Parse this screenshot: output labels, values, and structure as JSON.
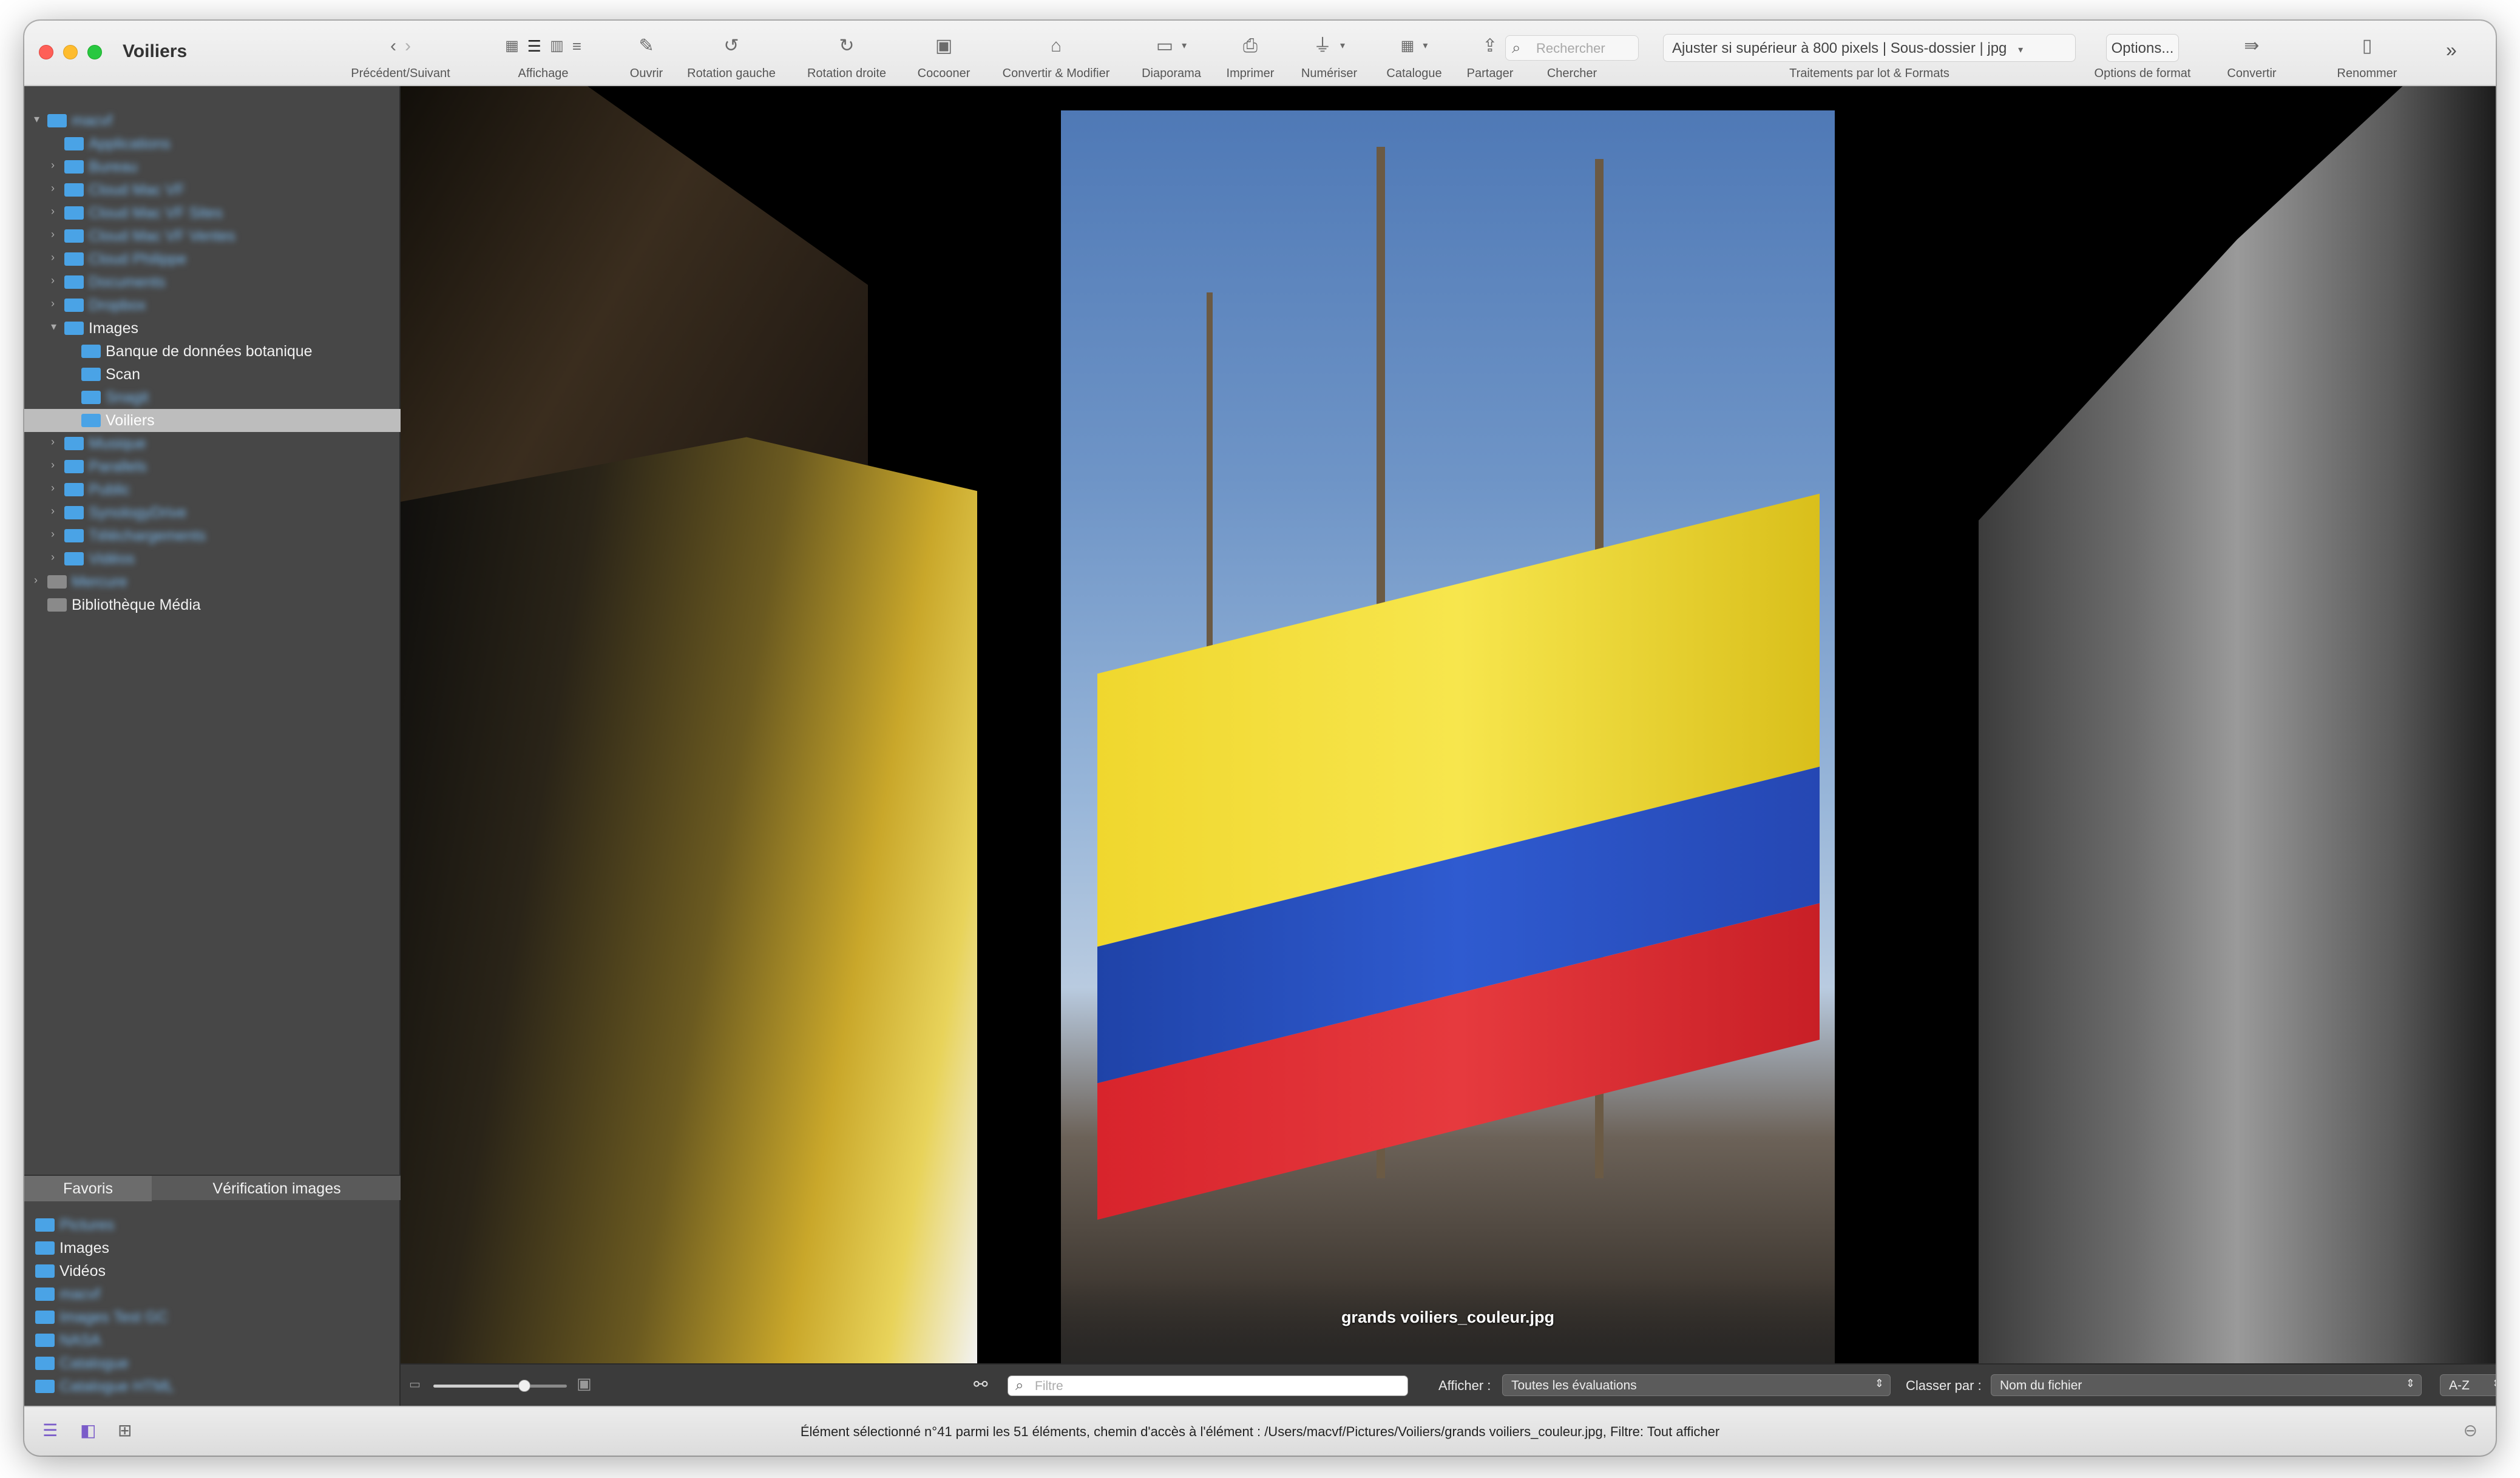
{
  "window": {
    "title": "Voiliers"
  },
  "toolbar": {
    "nav": {
      "prev_icon": "chevron-left-icon",
      "next_icon": "chevron-right-icon",
      "label": "Précédent/Suivant"
    },
    "view": {
      "label": "Affichage",
      "modes": [
        "grid-icon",
        "list-icon",
        "filmstrip-icon",
        "detail-list-icon"
      ]
    },
    "open": {
      "label": "Ouvrir",
      "icon": "open-icon"
    },
    "rotate_left": {
      "label": "Rotation gauche",
      "icon": "rotate-left-icon"
    },
    "rotate_right": {
      "label": "Rotation droite",
      "icon": "rotate-right-icon"
    },
    "cocoon": {
      "label": "Cocooner",
      "icon": "cocoon-icon"
    },
    "convert_modify": {
      "label": "Convertir & Modifier",
      "icon": "convert-modify-icon"
    },
    "slideshow": {
      "label": "Diaporama",
      "icon": "slideshow-icon"
    },
    "print": {
      "label": "Imprimer",
      "icon": "printer-icon"
    },
    "scan": {
      "label": "Numériser",
      "icon": "scanner-icon"
    },
    "catalog": {
      "label": "Catalogue",
      "icon": "catalog-icon"
    },
    "share": {
      "label": "Partager",
      "icon": "share-icon"
    },
    "search": {
      "placeholder": "Rechercher",
      "label": "Chercher"
    },
    "batch": {
      "value": "Ajuster si supérieur à 800 pixels | Sous-dossier | jpg",
      "label": "Traitements par lot & Formats"
    },
    "format_options": {
      "button": "Options...",
      "label": "Options de format"
    },
    "convert": {
      "label": "Convertir",
      "icon": "convert-icon"
    },
    "rename": {
      "label": "Renommer",
      "icon": "rename-icon"
    }
  },
  "sidebar": {
    "tree": [
      {
        "label": "macvf",
        "blurred": true
      },
      {
        "label": "Applications",
        "blurred": true
      },
      {
        "label": "Bureau",
        "blurred": true
      },
      {
        "label": "Cloud Mac VF",
        "blurred": true
      },
      {
        "label": "Cloud Mac VF Sites",
        "blurred": true
      },
      {
        "label": "Cloud Mac VF Ventes",
        "blurred": true
      },
      {
        "label": "Cloud Philippe",
        "blurred": true
      },
      {
        "label": "Documents",
        "blurred": true
      },
      {
        "label": "Dropbox",
        "blurred": true
      },
      {
        "label": "Images",
        "blurred": false
      },
      {
        "label": "Banque de données botanique",
        "blurred": false
      },
      {
        "label": "Scan",
        "blurred": false
      },
      {
        "label": "Snagit",
        "blurred": true
      },
      {
        "label": "Voiliers",
        "blurred": false
      },
      {
        "label": "Musique",
        "blurred": true
      },
      {
        "label": "Parallels",
        "blurred": true
      },
      {
        "label": "Public",
        "blurred": true
      },
      {
        "label": "SynologyDrive",
        "blurred": true
      },
      {
        "label": "Téléchargements",
        "blurred": true
      },
      {
        "label": "Vidéos",
        "blurred": true
      },
      {
        "label": "Mercure",
        "blurred": true
      },
      {
        "label": "Bibliothèque Média",
        "blurred": false
      }
    ],
    "tabs": [
      "Favoris",
      "Vérification images"
    ],
    "favorites": [
      {
        "label": "Pictures",
        "blurred": true
      },
      {
        "label": "Images",
        "blurred": false
      },
      {
        "label": "Vidéos",
        "blurred": false
      },
      {
        "label": "macvf",
        "blurred": true
      },
      {
        "label": "Images Test GC",
        "blurred": true
      },
      {
        "label": "NASA",
        "blurred": true
      },
      {
        "label": "Catalogue",
        "blurred": true
      },
      {
        "label": "Catalogue HTML",
        "blurred": true
      }
    ]
  },
  "viewer": {
    "caption": "grands voiliers_couleur.jpg",
    "zoom_level": 0.68,
    "filter_placeholder": "Filtre",
    "show_label": "Afficher :",
    "show_value": "Toutes les évaluations",
    "sort_label": "Classer par :",
    "sort_value": "Nom du fichier",
    "order_value": "A-Z"
  },
  "status": {
    "text": "Élément sélectionné n°41 parmi les 51 éléments, chemin d'accès à l'élément : /Users/macvf/Pictures/Voiliers/grands voiliers_couleur.jpg, Filtre: Tout afficher"
  },
  "colors": {
    "accent_folder": "#4aa3e6",
    "selection": "#bdbdbd",
    "flag_yellow": "#f0d72e",
    "flag_blue": "#2f5bd0",
    "flag_red": "#d8242c"
  }
}
